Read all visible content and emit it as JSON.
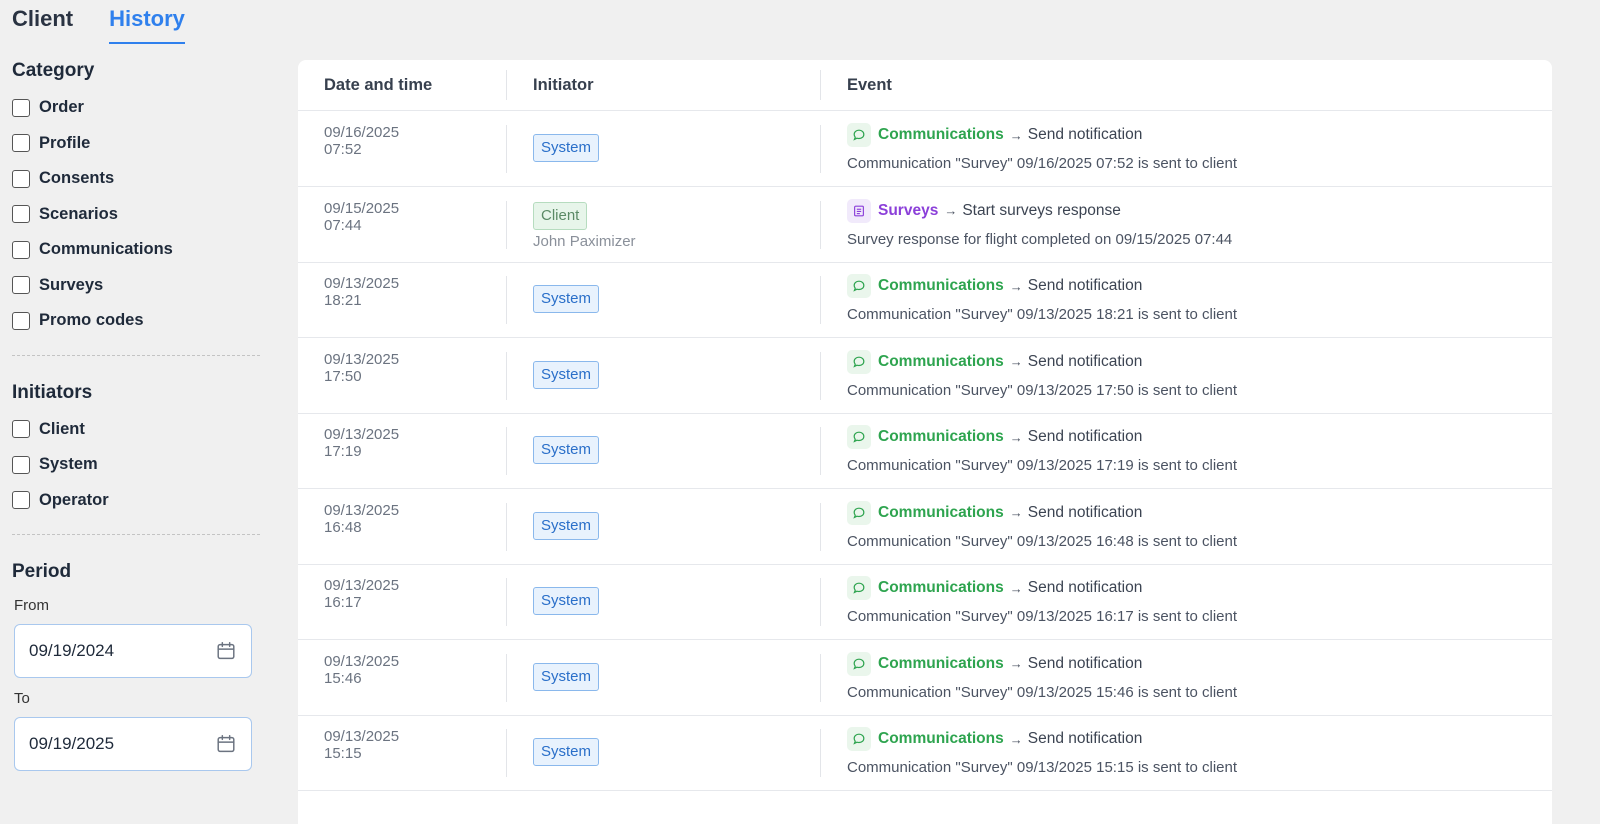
{
  "tabs": [
    {
      "label": "Client",
      "active": false
    },
    {
      "label": "History",
      "active": true
    }
  ],
  "sidebar": {
    "category": {
      "title": "Category",
      "items": [
        "Order",
        "Profile",
        "Consents",
        "Scenarios",
        "Communications",
        "Surveys",
        "Promo codes"
      ]
    },
    "initiators": {
      "title": "Initiators",
      "items": [
        "Client",
        "System",
        "Operator"
      ]
    },
    "period": {
      "title": "Period",
      "from_label": "From",
      "from_value": "09/19/2024",
      "to_label": "To",
      "to_value": "09/19/2025"
    }
  },
  "table": {
    "headers": {
      "date": "Date and time",
      "initiator": "Initiator",
      "event": "Event"
    },
    "rows": [
      {
        "date": "09/16/2025",
        "time": "07:52",
        "initiator": "System",
        "initiator_type": "system",
        "initiator_name": "",
        "category": "Communications",
        "category_type": "comm",
        "action": "Send notification",
        "description": "Communication \"Survey\" 09/16/2025 07:52 is sent to client"
      },
      {
        "date": "09/15/2025",
        "time": "07:44",
        "initiator": "Client",
        "initiator_type": "client",
        "initiator_name": "John Paximizer",
        "category": "Surveys",
        "category_type": "surv",
        "action": "Start surveys response",
        "description": "Survey response for flight completed on 09/15/2025 07:44"
      },
      {
        "date": "09/13/2025",
        "time": "18:21",
        "initiator": "System",
        "initiator_type": "system",
        "initiator_name": "",
        "category": "Communications",
        "category_type": "comm",
        "action": "Send notification",
        "description": "Communication \"Survey\" 09/13/2025 18:21 is sent to client"
      },
      {
        "date": "09/13/2025",
        "time": "17:50",
        "initiator": "System",
        "initiator_type": "system",
        "initiator_name": "",
        "category": "Communications",
        "category_type": "comm",
        "action": "Send notification",
        "description": "Communication \"Survey\" 09/13/2025 17:50 is sent to client"
      },
      {
        "date": "09/13/2025",
        "time": "17:19",
        "initiator": "System",
        "initiator_type": "system",
        "initiator_name": "",
        "category": "Communications",
        "category_type": "comm",
        "action": "Send notification",
        "description": "Communication \"Survey\" 09/13/2025 17:19 is sent to client"
      },
      {
        "date": "09/13/2025",
        "time": "16:48",
        "initiator": "System",
        "initiator_type": "system",
        "initiator_name": "",
        "category": "Communications",
        "category_type": "comm",
        "action": "Send notification",
        "description": "Communication \"Survey\" 09/13/2025 16:48 is sent to client"
      },
      {
        "date": "09/13/2025",
        "time": "16:17",
        "initiator": "System",
        "initiator_type": "system",
        "initiator_name": "",
        "category": "Communications",
        "category_type": "comm",
        "action": "Send notification",
        "description": "Communication \"Survey\" 09/13/2025 16:17 is sent to client"
      },
      {
        "date": "09/13/2025",
        "time": "15:46",
        "initiator": "System",
        "initiator_type": "system",
        "initiator_name": "",
        "category": "Communications",
        "category_type": "comm",
        "action": "Send notification",
        "description": "Communication \"Survey\" 09/13/2025 15:46 is sent to client"
      },
      {
        "date": "09/13/2025",
        "time": "15:15",
        "initiator": "System",
        "initiator_type": "system",
        "initiator_name": "",
        "category": "Communications",
        "category_type": "comm",
        "action": "Send notification",
        "description": "Communication \"Survey\" 09/13/2025 15:15 is sent to client"
      }
    ]
  },
  "icons": {
    "communications": "chat-bubble-icon",
    "surveys": "survey-list-icon",
    "date_picker": "calendar-icon",
    "arrow": "arrow-right-icon"
  },
  "colors": {
    "accent": "#2f80ed",
    "communications": "#2ea44f",
    "surveys": "#8b3fd9",
    "system_badge_border": "#8ab8ec",
    "client_badge_border": "#b6dcbf"
  }
}
